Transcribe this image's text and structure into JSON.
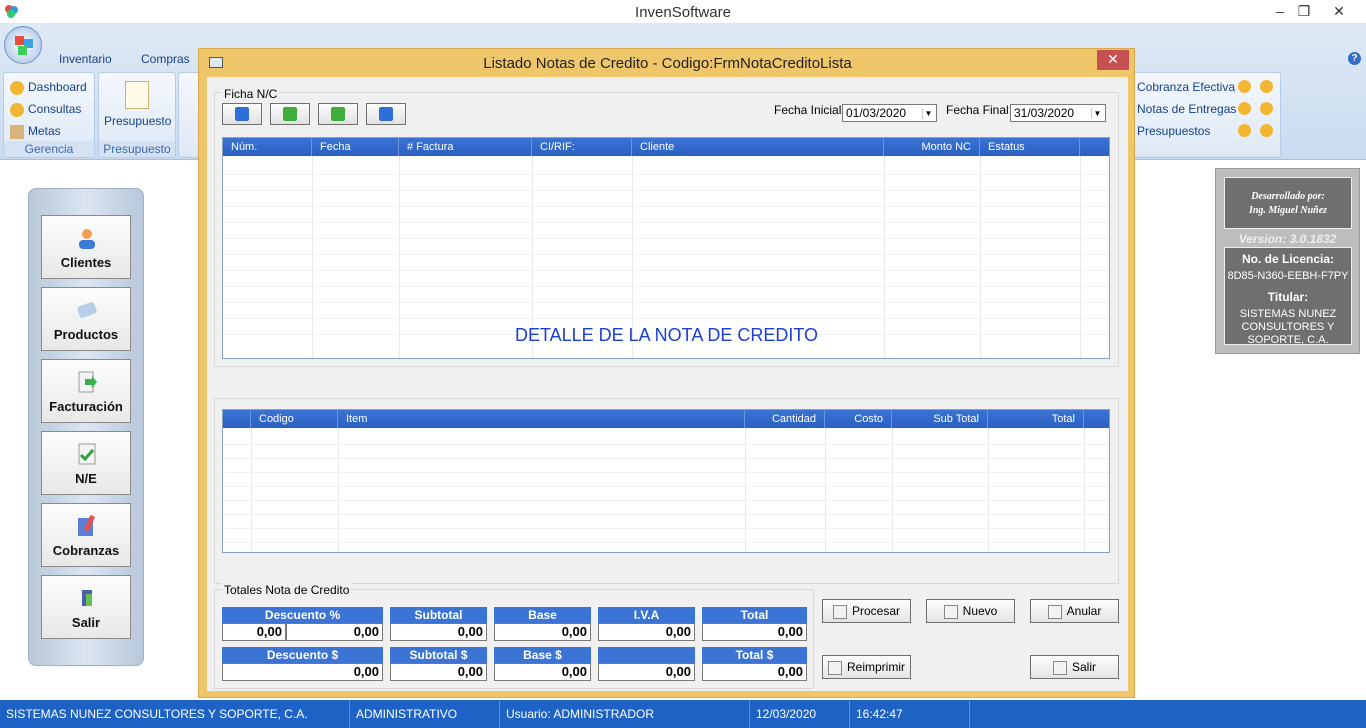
{
  "app": {
    "title": "InvenSoftware"
  },
  "menu": [
    "Inventario",
    "Compras"
  ],
  "ribbon": {
    "gerencia": {
      "items": [
        "Dashboard",
        "Consultas",
        "Metas"
      ],
      "label": "Gerencia"
    },
    "presupuesto": {
      "button": "Presupuesto",
      "label": "Presupuesto"
    },
    "right_items": [
      "Cobranza Efectiva",
      "Notas de Entregas",
      "Presupuestos"
    ]
  },
  "left_buttons": [
    "Clientes",
    "Productos",
    "Facturación",
    "N/E",
    "Cobranzas",
    "Salir"
  ],
  "info": {
    "developed_by": "Desarrollado por:",
    "developer": "Ing. Miguel Nuñez",
    "version": "Version: 3.0.1832",
    "license_label": "No. de Licencia:",
    "license": "8D85-N360-EEBH-F7PY",
    "holder_label": "Titular:",
    "holder": "SISTEMAS NUNEZ CONSULTORES Y SOPORTE, C.A."
  },
  "modal": {
    "title": "Listado Notas de Credito - Codigo:FrmNotaCreditoLista",
    "ficha_label": "Ficha N/C",
    "fecha_inicial_label": "Fecha Inicial:",
    "fecha_inicial": "01/03/2020",
    "fecha_final_label": "Fecha Final:",
    "fecha_final": "31/03/2020",
    "list_columns": [
      "Núm.",
      "Fecha",
      "# Factura",
      "CI/RIF:",
      "Cliente",
      "Monto NC",
      "Estatus"
    ],
    "detail_title": "DETALLE DE LA NOTA DE CREDITO",
    "detail_columns": [
      "Codigo",
      "Item",
      "Cantidad",
      "Costo",
      "Sub Total",
      "Total"
    ],
    "totals_label": "Totales Nota de Credito",
    "totals": {
      "descuento_pct_label": "Descuento %",
      "descuento_pct": "0,00",
      "descuento_pct_amount": "0,00",
      "subtotal_label": "Subtotal",
      "subtotal": "0,00",
      "base_label": "Base",
      "base": "0,00",
      "iva_label": "I.V.A",
      "iva": "0,00",
      "total_label": "Total",
      "total": "0,00",
      "descuento_usd_label": "Descuento $",
      "descuento_usd": "0,00",
      "subtotal_usd_label": "Subtotal $",
      "subtotal_usd": "0,00",
      "base_usd_label": "Base $",
      "base_usd": "0,00",
      "iva_usd_label": "",
      "iva_usd": "0,00",
      "total_usd_label": "Total $",
      "total_usd": "0,00"
    },
    "buttons": {
      "procesar": "Procesar",
      "nuevo": "Nuevo",
      "anular": "Anular",
      "reimprimir": "Reimprimir",
      "salir": "Salir"
    }
  },
  "status": {
    "company": "SISTEMAS NUNEZ CONSULTORES Y SOPORTE, C.A.",
    "role": "ADMINISTRATIVO",
    "user": "Usuario: ADMINISTRADOR",
    "date": "12/03/2020",
    "time": "16:42:47"
  },
  "colors": {
    "accent": "#2a5fc0",
    "status_bar": "#1e62c6",
    "modal_frame": "#f0c66a",
    "close": "#c75050"
  }
}
